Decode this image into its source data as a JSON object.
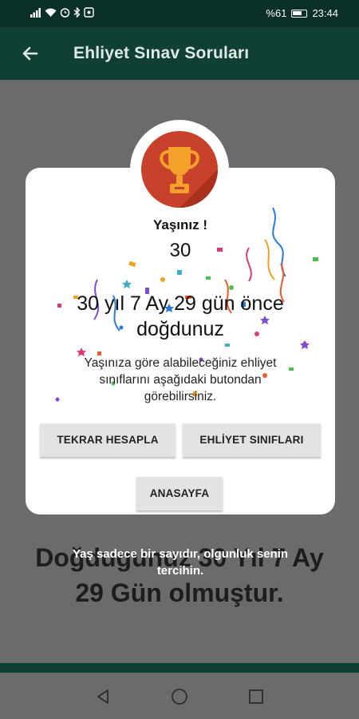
{
  "status_bar": {
    "battery_percent": "%61",
    "time": "23:44",
    "icons": [
      "signal-icon",
      "wifi-icon",
      "alarm-icon",
      "bluetooth-icon",
      "screenshot-icon"
    ]
  },
  "app_bar": {
    "title": "Ehliyet Sınav Soruları",
    "back_icon": "arrow-left-icon"
  },
  "background_result": {
    "line1": "Doğdugunuz 30 Yıl 7 Ay",
    "line2": "29 Gün olmuştur."
  },
  "dialog": {
    "icon": "trophy-icon",
    "age_label": "Yaşınız !",
    "age_value": "30",
    "born_line1": "30 yıl 7 Ay 29 gün önce",
    "born_line2": "doğdunuz",
    "info_line1": "Yaşınıza göre alabileceğiniz ehliyet",
    "info_line2": "sınıflarını aşağıdaki butondan",
    "info_line3": "görebilirsiniz.",
    "buttons": {
      "recalculate": "TEKRAR HESAPLA",
      "license_classes": "EHLİYET SINIFLARI",
      "home": "ANASAYFA"
    }
  },
  "toast": {
    "line1": "Yaş sadece bir sayıdır, olgunluk senin",
    "line2": "tercihin."
  },
  "nav_bar": {
    "icons": [
      "back-triangle-icon",
      "home-circle-icon",
      "recents-square-icon"
    ]
  },
  "colors": {
    "app_bar": "#103f35",
    "status_bar": "#0a2f28",
    "overlay": "#6b6b6b",
    "trophy_bg": "#c8412b",
    "trophy_gold": "#f3a12b"
  }
}
